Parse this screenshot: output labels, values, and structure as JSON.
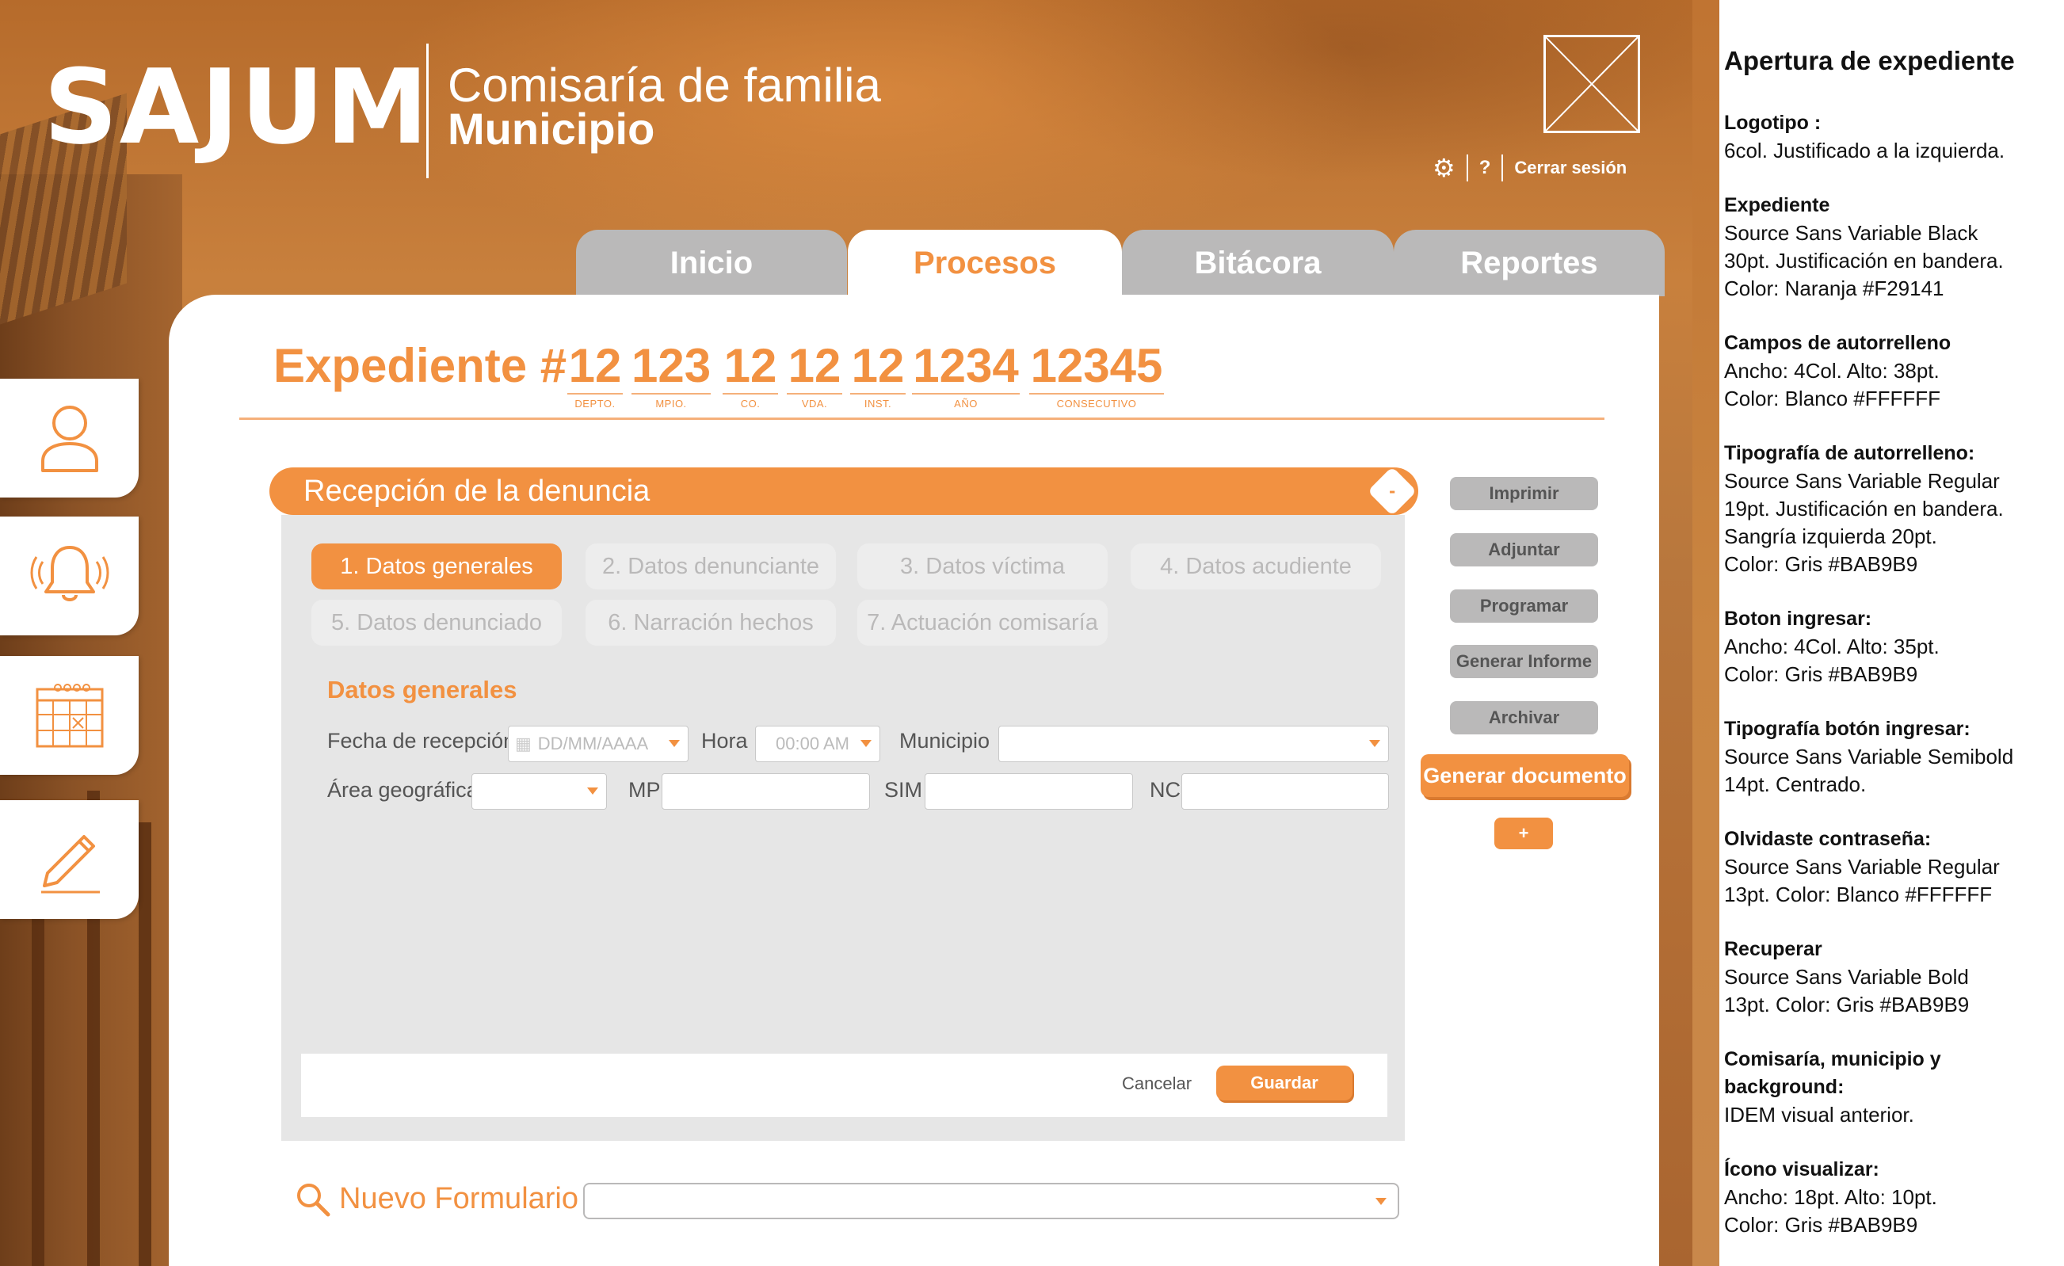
{
  "header": {
    "logo": "SAJUM",
    "subtitle_line1": "Comisaría de familia",
    "subtitle_line2": "Municipio",
    "help_label": "?",
    "logout_label": "Cerrar sesión"
  },
  "tabs": [
    {
      "label": "Inicio",
      "active": false
    },
    {
      "label": "Procesos",
      "active": true
    },
    {
      "label": "Bitácora",
      "active": false
    },
    {
      "label": "Reportes",
      "active": false
    }
  ],
  "sidenav": [
    {
      "icon": "user-icon"
    },
    {
      "icon": "bell-icon"
    },
    {
      "icon": "calendar-icon"
    },
    {
      "icon": "pencil-icon"
    }
  ],
  "expediente": {
    "title": "Expediente #",
    "fields": [
      {
        "value": "12",
        "caption": "DEPTO."
      },
      {
        "value": "123",
        "caption": "MPIO."
      },
      {
        "value": "12",
        "caption": "CO."
      },
      {
        "value": "12",
        "caption": "VDA."
      },
      {
        "value": "12",
        "caption": "INST."
      },
      {
        "value": "1234",
        "caption": "AÑO"
      },
      {
        "value": "12345",
        "caption": "CONSECUTIVO"
      }
    ]
  },
  "section": {
    "title": "Recepción de la denuncia",
    "steps": [
      {
        "label": "1. Datos generales",
        "active": true
      },
      {
        "label": "2. Datos denunciante",
        "active": false
      },
      {
        "label": "3. Datos víctima",
        "active": false
      },
      {
        "label": "4. Datos acudiente",
        "active": false
      },
      {
        "label": "5. Datos denunciado",
        "active": false
      },
      {
        "label": "6. Narración hechos",
        "active": false
      },
      {
        "label": "7. Actuación comisaría",
        "active": false
      }
    ],
    "form_title": "Datos generales",
    "fields": {
      "fecha_label": "Fecha de recepción",
      "fecha_placeholder": "DD/MM/AAAA",
      "hora_label": "Hora",
      "hora_placeholder": "00:00 AM",
      "municipio_label": "Municipio",
      "area_label": "Área geográfica",
      "mp_label": "MP",
      "sim_label": "SIM",
      "nc_label": "NC"
    },
    "cancel_label": "Cancelar",
    "save_label": "Guardar"
  },
  "actions": {
    "imprimir": "Imprimir",
    "adjuntar": "Adjuntar",
    "programar": "Programar",
    "generar_informe": "Generar Informe",
    "archivar": "Archivar",
    "generar_documento": "Generar documento",
    "add": "+"
  },
  "nuevo_formulario": {
    "label": "Nuevo Formulario"
  },
  "spec": {
    "title": "Apertura de expediente",
    "items": [
      {
        "heading": "Logotipo :",
        "lines": [
          "6col. Justificado a la izquierda."
        ]
      },
      {
        "heading": "Expediente",
        "lines": [
          "Source Sans Variable Black",
          "30pt. Justificación en bandera.",
          "Color: Naranja #F29141"
        ]
      },
      {
        "heading": "Campos de autorrelleno",
        "lines": [
          "Ancho: 4Col. Alto: 38pt.",
          "Color: Blanco #FFFFFF"
        ]
      },
      {
        "heading": "Tipografía de autorrelleno:",
        "lines": [
          "Source Sans Variable Regular",
          "19pt. Justificación en bandera.",
          "Sangría izquierda 20pt.",
          "Color: Gris #BAB9B9"
        ]
      },
      {
        "heading": "Boton ingresar:",
        "lines": [
          "Ancho: 4Col. Alto: 35pt.",
          "Color: Gris #BAB9B9"
        ]
      },
      {
        "heading": "Tipografía botón ingresar:",
        "lines": [
          "Source Sans Variable Semibold",
          "14pt. Centrado."
        ]
      },
      {
        "heading": "Olvidaste contraseña:",
        "lines": [
          "Source Sans Variable Regular",
          "13pt. Color: Blanco #FFFFFF"
        ]
      },
      {
        "heading": "Recuperar",
        "lines": [
          "Source Sans Variable Bold",
          "13pt. Color: Gris #BAB9B9"
        ]
      },
      {
        "heading": "Comisaría, municipio y background:",
        "lines": [
          "IDEM visual anterior."
        ]
      },
      {
        "heading": "Ícono visualizar:",
        "lines": [
          "Ancho: 18pt. Alto: 10pt.",
          "Color: Gris #BAB9B9"
        ]
      }
    ]
  },
  "colors": {
    "accent": "#F29141",
    "gray": "#BAB9B9",
    "white": "#FFFFFF"
  }
}
